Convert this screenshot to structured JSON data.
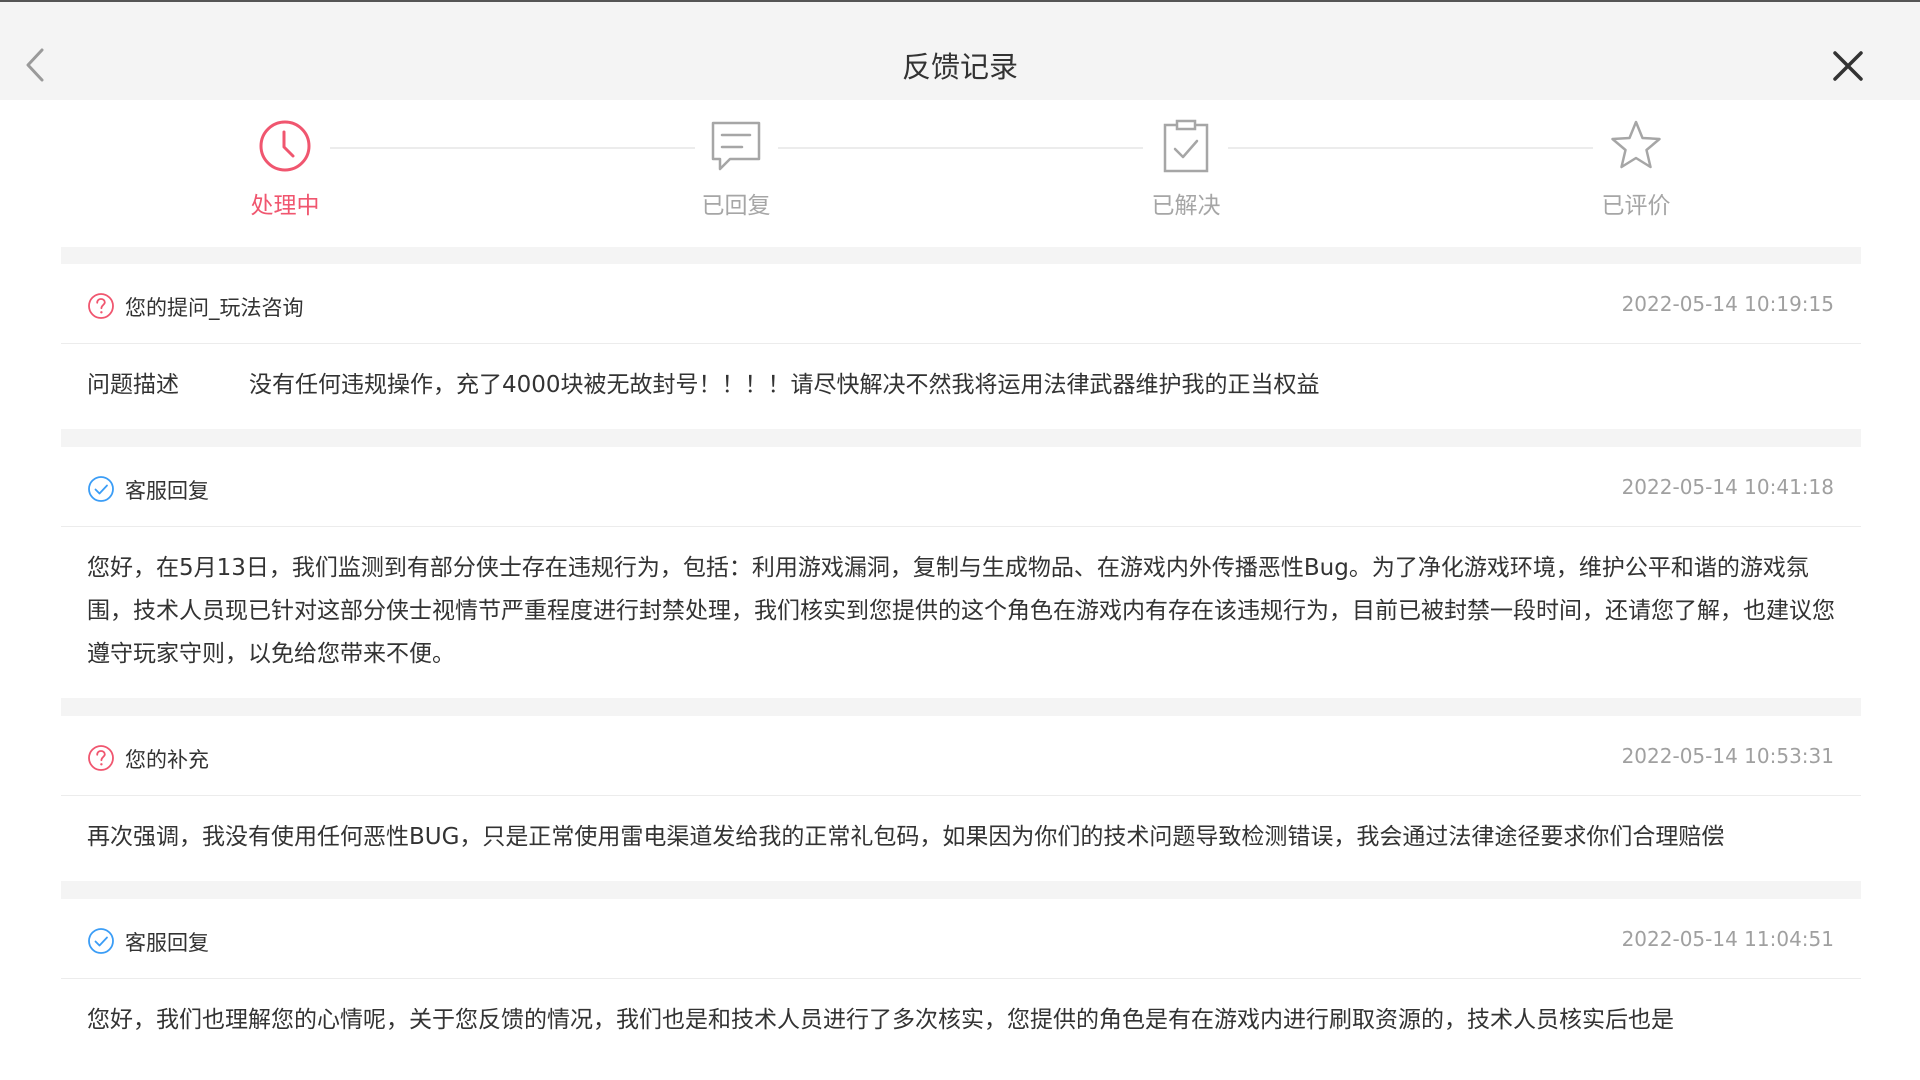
{
  "header": {
    "title": "反馈记录",
    "back_icon": "chevron-left-icon",
    "close_icon": "close-icon"
  },
  "steps": [
    {
      "label": "处理中",
      "icon": "clock-icon",
      "active": true
    },
    {
      "label": "已回复",
      "icon": "message-icon",
      "active": false
    },
    {
      "label": "已解决",
      "icon": "clipboard-check-icon",
      "active": false
    },
    {
      "label": "已评价",
      "icon": "star-icon",
      "active": false
    }
  ],
  "colors": {
    "accent": "#f0566f",
    "reply_blue": "#3b9df6",
    "muted": "#a6a6a6",
    "background_gray": "#f4f4f4"
  },
  "cards": [
    {
      "type": "question",
      "icon": "question-circle-icon",
      "title": "您的提问_玩法咨询",
      "time": "2022-05-14 10:19:15",
      "label": "问题描述",
      "body": "没有任何违规操作，充了4000块被无故封号！！！！请尽快解决不然我将运用法律武器维护我的正当权益"
    },
    {
      "type": "reply",
      "icon": "check-circle-icon",
      "title": "客服回复",
      "time": "2022-05-14 10:41:18",
      "body": "您好，在5月13日，我们监测到有部分侠士存在违规行为，包括：利用游戏漏洞，复制与生成物品、在游戏内外传播恶性Bug。为了净化游戏环境，维护公平和谐的游戏氛围，技术人员现已针对这部分侠士视情节严重程度进行封禁处理，我们核实到您提供的这个角色在游戏内有存在该违规行为，目前已被封禁一段时间，还请您了解，也建议您遵守玩家守则，以免给您带来不便。"
    },
    {
      "type": "question",
      "icon": "question-circle-icon",
      "title": "您的补充",
      "time": "2022-05-14 10:53:31",
      "body": "再次强调，我没有使用任何恶性BUG，只是正常使用雷电渠道发给我的正常礼包码，如果因为你们的技术问题导致检测错误，我会通过法律途径要求你们合理赔偿"
    },
    {
      "type": "reply",
      "icon": "check-circle-icon",
      "title": "客服回复",
      "time": "2022-05-14 11:04:51",
      "body": "您好，我们也理解您的心情呢，关于您反馈的情况，我们也是和技术人员进行了多次核实，您提供的角色是有在游戏内进行刷取资源的，技术人员核实后也是"
    }
  ]
}
